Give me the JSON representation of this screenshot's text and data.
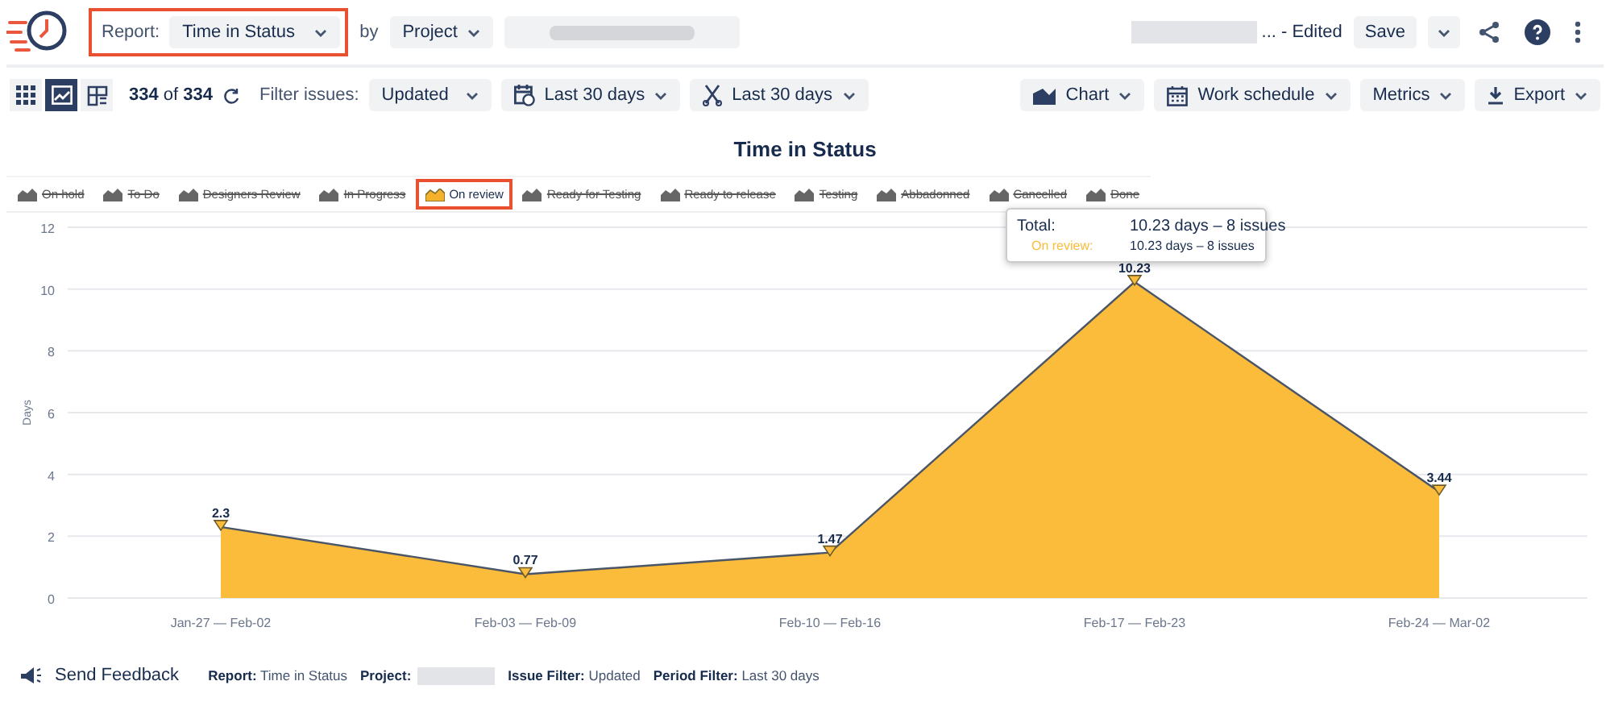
{
  "header": {
    "report_label": "Report:",
    "report_value": "Time in Status",
    "report_highlighted": true,
    "by_label": "by",
    "group_value": "Project",
    "edited_text": "... - Edited",
    "save_label": "Save"
  },
  "toolbar": {
    "views": [
      {
        "kind": "grid",
        "selected": false
      },
      {
        "kind": "chart",
        "selected": true
      },
      {
        "kind": "table",
        "selected": false
      }
    ],
    "count": "**334** of **334**",
    "filter_label": "Filter issues:",
    "filter_value": "Updated",
    "date_range": "Last 30 days",
    "period": "Last 30 days",
    "right_buttons": [
      {
        "kind": "chart",
        "label": "Chart"
      },
      {
        "kind": "calendar",
        "label": "Work schedule"
      },
      {
        "kind": "none",
        "label": "Metrics"
      },
      {
        "kind": "export",
        "label": "Export"
      }
    ]
  },
  "title": "Time in Status",
  "legend": [
    {
      "label": "On hold",
      "enabled": false,
      "highlighted": false
    },
    {
      "label": "To Do",
      "enabled": false,
      "highlighted": false
    },
    {
      "label": "Designers Review",
      "enabled": false,
      "highlighted": false
    },
    {
      "label": "In Progress",
      "enabled": false,
      "highlighted": false
    },
    {
      "label": "On review",
      "enabled": true,
      "highlighted": true
    },
    {
      "label": "Ready for Testing",
      "enabled": false,
      "highlighted": false
    },
    {
      "label": "Ready to release",
      "enabled": false,
      "highlighted": false
    },
    {
      "label": "Testing",
      "enabled": false,
      "highlighted": false
    },
    {
      "label": "Abbadonned",
      "enabled": false,
      "highlighted": false
    },
    {
      "label": "Cancelled",
      "enabled": false,
      "highlighted": false
    },
    {
      "label": "Done",
      "enabled": false,
      "highlighted": false
    }
  ],
  "chart_data": {
    "type": "area",
    "ylabel": "Days",
    "categories": [
      "Jan-27 — Feb-02",
      "Feb-03 — Feb-09",
      "Feb-10 — Feb-16",
      "Feb-17 — Feb-23",
      "Feb-24 — Mar-02"
    ],
    "values": [
      2.3,
      0.77,
      1.47,
      10.23,
      3.44
    ],
    "grid": true,
    "ylim": [
      0,
      12
    ],
    "yticks": [
      0,
      2,
      4,
      6,
      8,
      10,
      12
    ],
    "data_labels": true
  },
  "tooltip": {
    "total_label": "Total:",
    "total_value": "10.23 days – 8 issues",
    "series_label": "On review:",
    "series_value": "10.23 days – 8 issues"
  },
  "footer": {
    "feedback": "Send Feedback",
    "report": "**Report:** Time in Status",
    "project_label": "Project:",
    "issue_filter": "**Issue Filter:** Updated",
    "period_filter": "**Period Filter:** Last 30 days"
  }
}
